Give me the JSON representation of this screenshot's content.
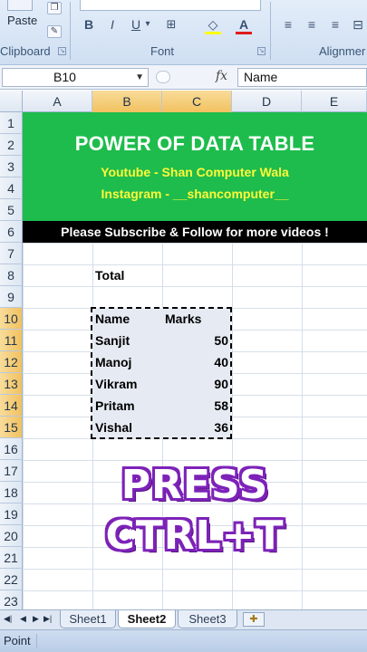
{
  "ribbon": {
    "paste_label": "Paste",
    "clipboard_label": "Clipboard",
    "font_label": "Font",
    "alignment_label": "Alignmer",
    "bold": "B",
    "italic": "I",
    "underline": "U",
    "underline_arrow": "▾",
    "fill_icon": "bucket-icon",
    "font_color_letter": "A"
  },
  "formula_bar": {
    "name_box": "B10",
    "fx": "fx",
    "formula": "Name"
  },
  "columns": [
    "A",
    "B",
    "C",
    "D",
    "E"
  ],
  "rows": [
    "1",
    "2",
    "3",
    "4",
    "5",
    "6",
    "7",
    "8",
    "9",
    "10",
    "11",
    "12",
    "13",
    "14",
    "15",
    "16",
    "17",
    "18",
    "19",
    "20",
    "21",
    "22",
    "23"
  ],
  "banner": {
    "title": "POWER OF DATA TABLE",
    "youtube": "Youtube - Shan Computer Wala",
    "instagram": "Instagram - __shancomputer__",
    "subscribe": "Please Subscribe & Follow for more videos !",
    "green": "#1ebc4c",
    "yellow": "#fff93a"
  },
  "sheet": {
    "total_label": "Total",
    "header_name": "Name",
    "header_marks": "Marks",
    "data": [
      {
        "name": "Sanjit",
        "marks": "50"
      },
      {
        "name": "Manoj",
        "marks": "40"
      },
      {
        "name": "Vikram",
        "marks": "90"
      },
      {
        "name": "Pritam",
        "marks": "58"
      },
      {
        "name": "Vishal",
        "marks": "36"
      }
    ]
  },
  "overlay": {
    "line1": "PRESS",
    "line2": "CTRL+T",
    "outline_color": "#7d22b8"
  },
  "tabs": {
    "items": [
      "Sheet1",
      "Sheet2",
      "Sheet3"
    ],
    "active": "Sheet2"
  },
  "status": {
    "mode": "Point"
  }
}
